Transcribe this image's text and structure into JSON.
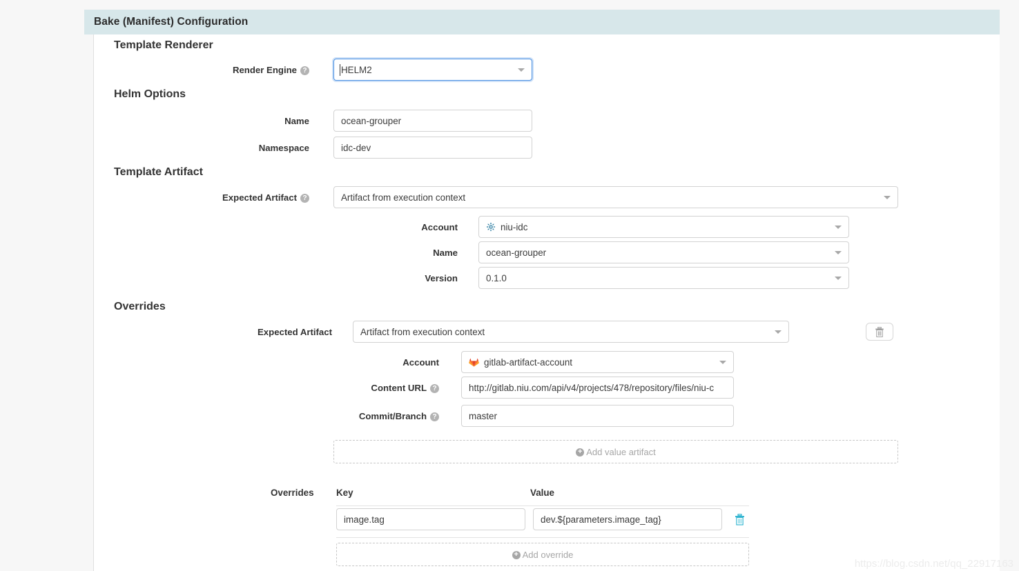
{
  "panel": {
    "title": "Bake (Manifest) Configuration",
    "header_bg": "#d7e7ea"
  },
  "sections": {
    "template_renderer": {
      "title": "Template Renderer",
      "render_engine": {
        "label": "Render Engine",
        "help": "?",
        "value": "HELM2",
        "focused": true
      }
    },
    "helm_options": {
      "title": "Helm Options",
      "name": {
        "label": "Name",
        "value": "ocean-grouper"
      },
      "namespace": {
        "label": "Namespace",
        "value": "idc-dev"
      }
    },
    "template_artifact": {
      "title": "Template Artifact",
      "expected_artifact": {
        "label": "Expected Artifact",
        "help": "?",
        "value": "Artifact from execution context"
      },
      "account": {
        "label": "Account",
        "value": "niu-idc",
        "icon": "helm-icon"
      },
      "name": {
        "label": "Name",
        "value": "ocean-grouper"
      },
      "version": {
        "label": "Version",
        "value": "0.1.0"
      }
    },
    "overrides": {
      "title": "Overrides",
      "expected_artifact": {
        "label": "Expected Artifact",
        "value": "Artifact from execution context"
      },
      "delete_artifact_button": {
        "icon": "trash-icon"
      },
      "account": {
        "label": "Account",
        "value": "gitlab-artifact-account",
        "icon": "gitlab-icon"
      },
      "content_url": {
        "label": "Content URL",
        "help": "?",
        "value": "http://gitlab.niu.com/api/v4/projects/478/repository/files/niu-c"
      },
      "commit_branch": {
        "label": "Commit/Branch",
        "help": "?",
        "value": "master"
      },
      "add_value_artifact": {
        "label": "Add value artifact",
        "icon": "plus-circle-icon"
      },
      "table": {
        "label": "Overrides",
        "columns": [
          "Key",
          "Value"
        ],
        "rows": [
          {
            "key": "image.tag",
            "value": "dev.${parameters.image_tag}",
            "delete_icon": "trash-icon"
          }
        ],
        "add_row": {
          "label": "Add override",
          "icon": "plus-circle-icon"
        }
      }
    }
  },
  "watermark": {
    "text": "https://blog.csdn.net/qq_22917163"
  }
}
